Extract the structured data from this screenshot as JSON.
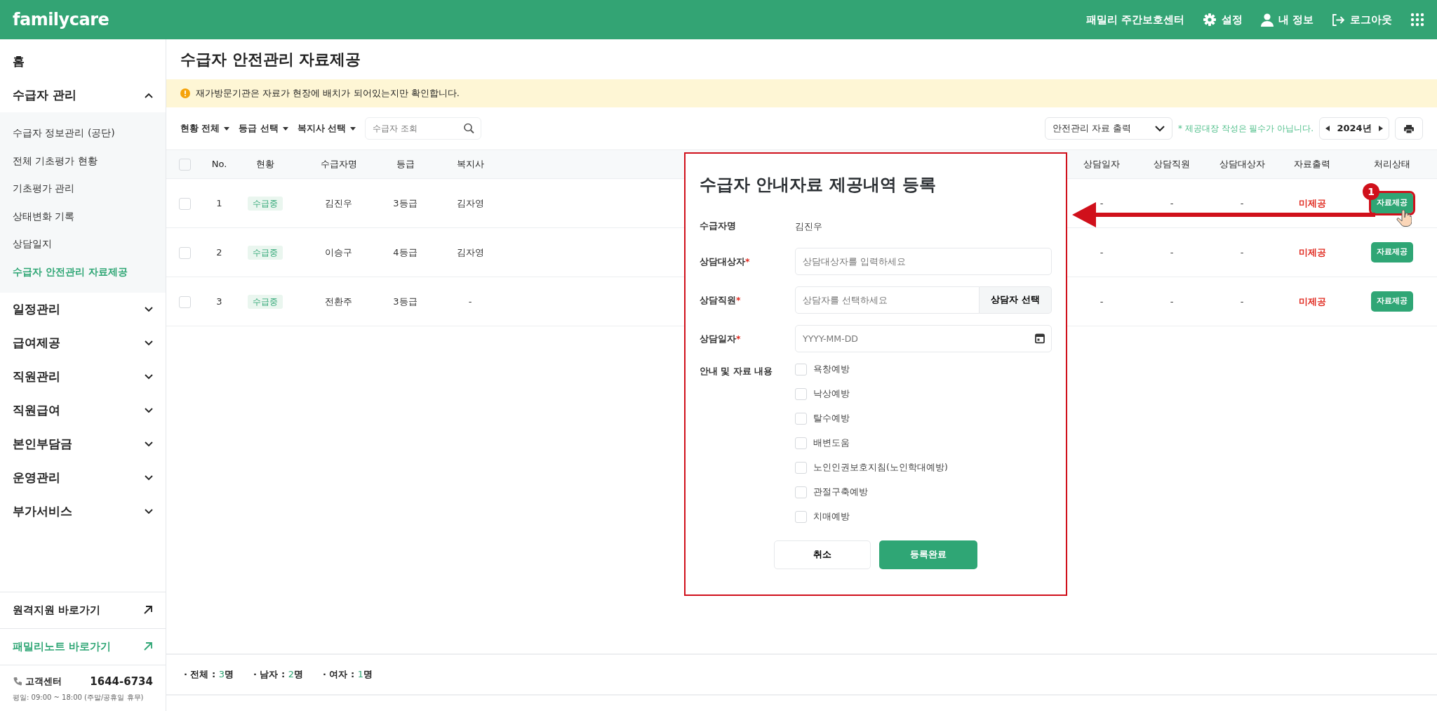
{
  "header": {
    "logo": "familycare",
    "center_name": "패밀리 주간보호센터",
    "links": [
      {
        "kind": "settings",
        "label": "설정"
      },
      {
        "kind": "profile",
        "label": "내 정보"
      },
      {
        "kind": "logout",
        "label": "로그아웃"
      }
    ]
  },
  "sidebar": {
    "items": [
      {
        "label": "홈",
        "expandable": false
      },
      {
        "label": "수급자 관리",
        "expandable": true,
        "expanded": true,
        "children": [
          {
            "label": "수급자 정보관리 (공단)",
            "selected": false
          },
          {
            "label": "전체 기초평가 현황",
            "selected": false
          },
          {
            "label": "기초평가 관리",
            "selected": false
          },
          {
            "label": "상태변화 기록",
            "selected": false
          },
          {
            "label": "상담일지",
            "selected": false
          },
          {
            "label": "수급자 안전관리 자료제공",
            "selected": true
          }
        ]
      },
      {
        "label": "일정관리",
        "expandable": true,
        "expanded": false
      },
      {
        "label": "급여제공",
        "expandable": true,
        "expanded": false
      },
      {
        "label": "직원관리",
        "expandable": true,
        "expanded": false
      },
      {
        "label": "직원급여",
        "expandable": true,
        "expanded": false
      },
      {
        "label": "본인부담금",
        "expandable": true,
        "expanded": false
      },
      {
        "label": "운영관리",
        "expandable": true,
        "expanded": false
      },
      {
        "label": "부가서비스",
        "expandable": true,
        "expanded": false
      }
    ],
    "shortcuts": [
      {
        "label": "원격지원 바로가기",
        "color": "#222222"
      },
      {
        "label": "패밀리노트 바로가기",
        "color": "#2fa675"
      }
    ],
    "support": {
      "label": "고객센터",
      "phone": "1644-6734",
      "hours": "평일: 09:00 ~ 18:00 (주말/공휴일 휴무)"
    }
  },
  "page_title": "수급자 안전관리 자료제공",
  "alert": "재가방문기관은 자료가 현장에 배치가 되어있는지만 확인합니다.",
  "toolbar": {
    "filters": [
      "현황 전체",
      "등급 선택",
      "복지사 선택"
    ],
    "search": {
      "placeholder": "수급자 조회"
    },
    "export_select": "안전관리 자료 출력",
    "note": "* 제공대장 작성은 필수가 아닙니다.",
    "year": "2024년"
  },
  "table": {
    "all_checked": false,
    "columns": [
      "No.",
      "현황",
      "수급자명",
      "등급",
      "복지사",
      "상담일자",
      "상담직원",
      "상담대상자",
      "자료출력",
      "처리상태"
    ],
    "rows": [
      {
        "checked": false,
        "no": "1",
        "status": "수급중",
        "name": "김진우",
        "grade": "3등급",
        "worker": "김자영",
        "date": "-",
        "staff": "-",
        "target": "-",
        "output": "미제공",
        "action": "자료제공",
        "highlighted": true
      },
      {
        "checked": false,
        "no": "2",
        "status": "수급중",
        "name": "이승구",
        "grade": "4등급",
        "worker": "김자영",
        "date": "-",
        "staff": "-",
        "target": "-",
        "output": "미제공",
        "action": "자료제공",
        "highlighted": false
      },
      {
        "checked": false,
        "no": "3",
        "status": "수급중",
        "name": "전환주",
        "grade": "3등급",
        "worker": "-",
        "date": "-",
        "staff": "-",
        "target": "-",
        "output": "미제공",
        "action": "자료제공",
        "highlighted": false
      }
    ]
  },
  "annotation": {
    "marker": "1"
  },
  "modal": {
    "title": "수급자 안내자료 제공내역 등록",
    "fields": [
      {
        "kind": "text",
        "label": "수급자명",
        "value": "김진우"
      },
      {
        "kind": "input",
        "label": "상담대상자",
        "required_mark": "*",
        "placeholder": "상담대상자를 입력하세요"
      },
      {
        "kind": "input_button",
        "label": "상담직원",
        "required_mark": "*",
        "placeholder": "상담자를 선택하세요",
        "button": "상담자 선택"
      },
      {
        "kind": "date",
        "label": "상담일자",
        "required_mark": "*",
        "placeholder": "YYYY-MM-DD"
      },
      {
        "kind": "checklist",
        "label": "안내 및 자료 내용",
        "options": [
          {
            "label": "욕창예방",
            "checked": false
          },
          {
            "label": "낙상예방",
            "checked": false
          },
          {
            "label": "탈수예방",
            "checked": false
          },
          {
            "label": "배변도움",
            "checked": false
          },
          {
            "label": "노인인권보호지침(노인학대예방)",
            "checked": false
          },
          {
            "label": "관절구축예방",
            "checked": false
          },
          {
            "label": "치매예방",
            "checked": false
          }
        ]
      }
    ],
    "buttons": [
      {
        "kind": "cancel",
        "label": "취소"
      },
      {
        "kind": "submit",
        "label": "등록완료"
      }
    ]
  },
  "summary": [
    {
      "label": "· 전체 :",
      "count": "3",
      "unit": "명"
    },
    {
      "label": "· 남자 :",
      "count": "2",
      "unit": "명"
    },
    {
      "label": "· 여자 :",
      "count": "1",
      "unit": "명"
    }
  ]
}
